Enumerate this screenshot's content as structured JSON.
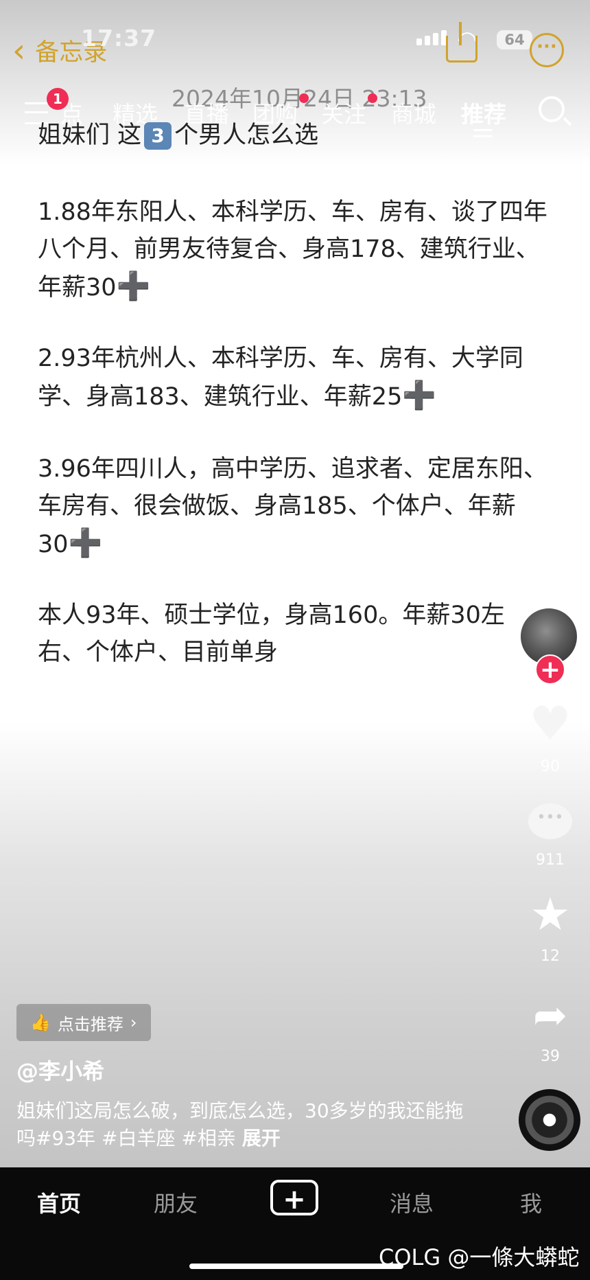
{
  "status_bar": {
    "time": "17:37",
    "battery": "64"
  },
  "notes_header": {
    "back_label": "备忘录",
    "date": "2024年10月24日 23:13"
  },
  "feed_tabs": {
    "menu_badge": "1",
    "items": [
      "点",
      "精选",
      "直播",
      "团购",
      "关注",
      "商城",
      "推荐"
    ],
    "active": "推荐"
  },
  "note": {
    "title_before": "姐妹们 这",
    "title_keycap": "3",
    "title_after": "个男人怎么选",
    "p1": " 1.88年东阳人、本科学历、车、房有、谈了四年八个月、前男友待复合、身高178、建筑行业、年薪30",
    "p2": " 2.93年杭州人、本科学历、车、房有、大学同学、身高183、建筑行业、年薪25",
    "p3": "3.96年四川人，高中学历、追求者、定居东阳、车房有、很会做饭、身高185、个体户、年薪30",
    "p4": " 本人93年、硕士学位，身高160。年薪30左右、个体户、目前单身",
    "plus_symbol": "➕"
  },
  "actions": {
    "likes": "90",
    "comments": "911",
    "favorites": "12",
    "shares": "39"
  },
  "video_info": {
    "recommend_label": "点击推荐",
    "username": "@李小希",
    "caption": "姐妹们这局怎么破，到底怎么选，30多岁的我还能拖吗#93年 #白羊座 #相亲",
    "expand_label": "展开"
  },
  "bottom_nav": {
    "home": "首页",
    "friends": "朋友",
    "create": "+",
    "messages": "消息",
    "me": "我"
  },
  "watermark": "COLG @一條大蟒蛇",
  "colors": {
    "accent_gold": "#d1a32c",
    "badge_red": "#ef2d55",
    "nav_bg": "#0a0a0a"
  }
}
